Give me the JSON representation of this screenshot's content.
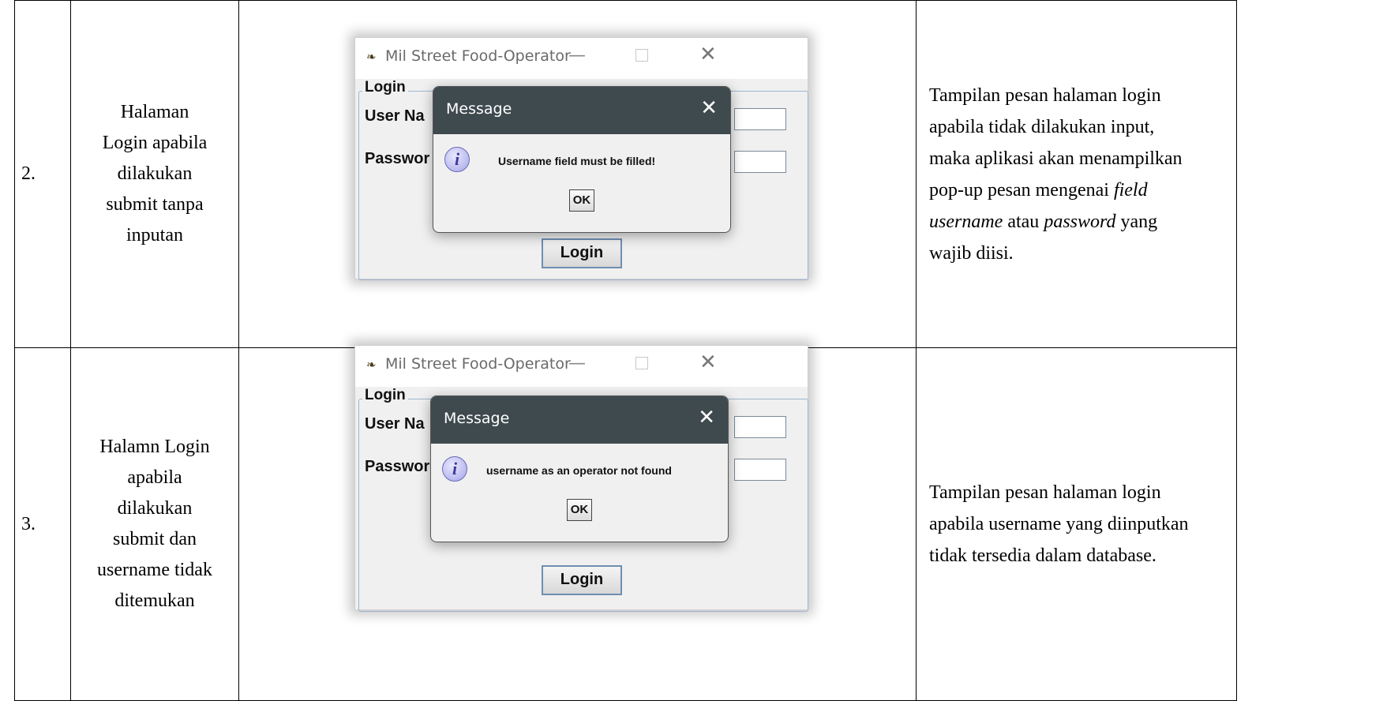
{
  "rows": [
    {
      "number": "2.",
      "name_lines": [
        "Halaman",
        "Login apabila",
        "dilakukan",
        "submit tanpa",
        "inputan"
      ],
      "window": {
        "title": "Mil Street Food-Operator",
        "group_title": "Login",
        "user_label": "User Na",
        "password_label": "Passwor",
        "login_button": "Login"
      },
      "dialog": {
        "title": "Message",
        "message": "Username field must be filled!",
        "ok_button": "OK"
      },
      "desc_lines": [
        {
          "parts": [
            {
              "t": "Tampilan pesan halaman login",
              "i": false
            }
          ]
        },
        {
          "parts": [
            {
              "t": "apabila tidak dilakukan input,",
              "i": false
            }
          ]
        },
        {
          "parts": [
            {
              "t": "maka aplikasi akan menampilkan",
              "i": false
            }
          ]
        },
        {
          "parts": [
            {
              "t": "pop-up pesan mengenai ",
              "i": false
            },
            {
              "t": "field",
              "i": true
            }
          ]
        },
        {
          "parts": [
            {
              "t": "username",
              "i": true
            },
            {
              "t": " atau ",
              "i": false
            },
            {
              "t": "password",
              "i": true
            },
            {
              "t": " yang",
              "i": false
            }
          ]
        },
        {
          "parts": [
            {
              "t": "wajib diisi.",
              "i": false
            }
          ]
        }
      ]
    },
    {
      "number": "3.",
      "name_lines": [
        "Halamn Login",
        "apabila",
        "dilakukan",
        "submit dan",
        "username tidak",
        "ditemukan"
      ],
      "window": {
        "title": "Mil Street Food-Operator",
        "group_title": "Login",
        "user_label": "User Na",
        "password_label": "Passwor",
        "login_button": "Login"
      },
      "dialog": {
        "title": "Message",
        "message": "username as an operator not found",
        "ok_button": "OK"
      },
      "desc_lines": [
        {
          "parts": [
            {
              "t": "Tampilan pesan halaman login",
              "i": false
            }
          ]
        },
        {
          "parts": [
            {
              "t": "apabila username yang diinputkan",
              "i": false
            }
          ]
        },
        {
          "parts": [
            {
              "t": "tidak tersedia dalam database.",
              "i": false
            }
          ]
        }
      ]
    }
  ],
  "icons": {
    "app_icon": "bird-logo-icon",
    "minimize": "minimize-icon",
    "maximize": "maximize-icon",
    "close": "close-icon",
    "info": "info-icon"
  }
}
